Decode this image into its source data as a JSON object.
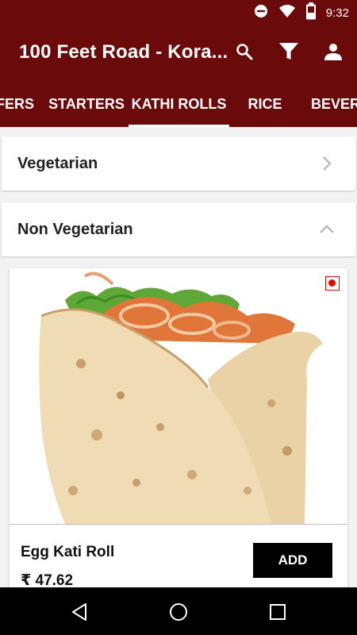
{
  "status_bar": {
    "time": "9:32",
    "icons": [
      "do-not-disturb-icon",
      "wifi-icon",
      "battery-icon"
    ]
  },
  "app_bar": {
    "title": "100 Feet Road - Kora...",
    "actions": [
      "search-icon",
      "filter-icon",
      "account-icon"
    ]
  },
  "tabs": [
    {
      "label": "OFFERS",
      "active": false
    },
    {
      "label": "STARTERS",
      "active": false
    },
    {
      "label": "KATHI ROLLS",
      "active": true
    },
    {
      "label": "RICE",
      "active": false
    },
    {
      "label": "BEVERAGES",
      "active": false
    }
  ],
  "sections": [
    {
      "label": "Vegetarian",
      "state": "collapsed",
      "icon": "chevron-right-icon"
    },
    {
      "label": "Non Vegetarian",
      "state": "expanded",
      "icon": "chevron-up-icon"
    }
  ],
  "item": {
    "name": "Egg Kati Roll",
    "price": "₹ 47.62",
    "add_label": "ADD",
    "diet_indicator": "non-veg",
    "image": "kathi-roll-photo"
  },
  "nav_bar": {
    "buttons": [
      "back-icon",
      "home-icon",
      "recents-icon"
    ]
  },
  "colors": {
    "primary": "#6b0a0a",
    "non_veg_red": "#e00000",
    "button_black": "#000000"
  }
}
